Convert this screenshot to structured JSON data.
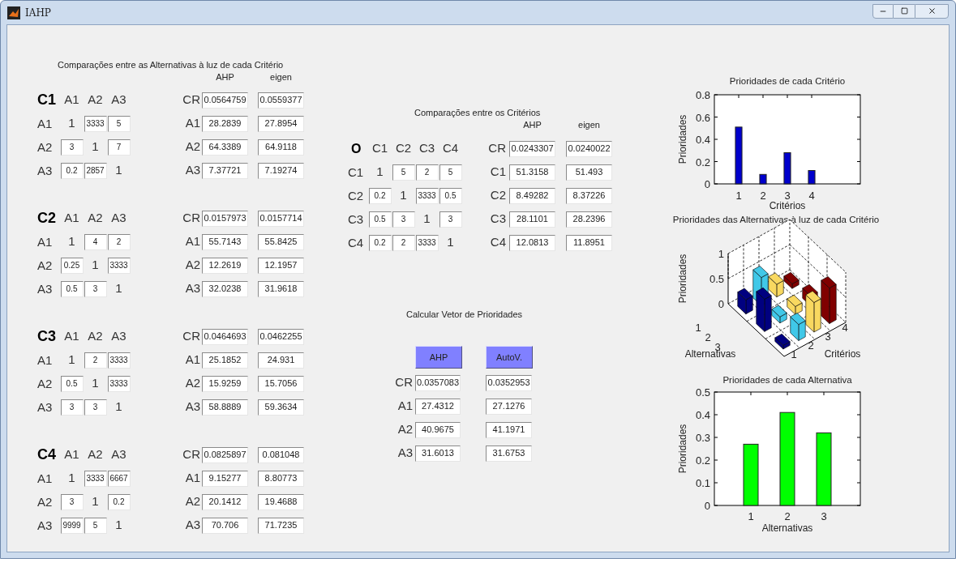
{
  "window": {
    "title": "IAHP"
  },
  "alternatives_panel": {
    "title": "Comparações entre as Alternativas à luz de cada Critério",
    "result_headers": [
      "AHP",
      "eigen"
    ],
    "blocks": [
      {
        "name": "C1",
        "columns": [
          "A1",
          "A2",
          "A3"
        ],
        "rows": [
          {
            "label": "A1",
            "cells": [
              {
                "kind": "text",
                "value": "1"
              },
              {
                "kind": "field",
                "value": "3333"
              },
              {
                "kind": "field",
                "value": "5"
              }
            ]
          },
          {
            "label": "A2",
            "cells": [
              {
                "kind": "field",
                "value": "3"
              },
              {
                "kind": "text",
                "value": "1"
              },
              {
                "kind": "field",
                "value": "7"
              }
            ]
          },
          {
            "label": "A3",
            "cells": [
              {
                "kind": "field",
                "value": "0.2"
              },
              {
                "kind": "field",
                "value": "2857"
              },
              {
                "kind": "text",
                "value": "1"
              }
            ]
          }
        ],
        "results": [
          {
            "label": "CR",
            "values": [
              "0.0564759",
              "0.0559377"
            ]
          },
          {
            "label": "A1",
            "values": [
              "28.2839",
              "27.8954"
            ]
          },
          {
            "label": "A2",
            "values": [
              "64.3389",
              "64.9118"
            ]
          },
          {
            "label": "A3",
            "values": [
              "7.37721",
              "7.19274"
            ]
          }
        ]
      },
      {
        "name": "C2",
        "columns": [
          "A1",
          "A2",
          "A3"
        ],
        "rows": [
          {
            "label": "A1",
            "cells": [
              {
                "kind": "text",
                "value": "1"
              },
              {
                "kind": "field",
                "value": "4"
              },
              {
                "kind": "field",
                "value": "2"
              }
            ]
          },
          {
            "label": "A2",
            "cells": [
              {
                "kind": "field",
                "value": "0.25"
              },
              {
                "kind": "text",
                "value": "1"
              },
              {
                "kind": "field",
                "value": "3333"
              }
            ]
          },
          {
            "label": "A3",
            "cells": [
              {
                "kind": "field",
                "value": "0.5"
              },
              {
                "kind": "field",
                "value": "3"
              },
              {
                "kind": "text",
                "value": "1"
              }
            ]
          }
        ],
        "results": [
          {
            "label": "CR",
            "values": [
              "0.0157973",
              "0.0157714"
            ]
          },
          {
            "label": "A1",
            "values": [
              "55.7143",
              "55.8425"
            ]
          },
          {
            "label": "A2",
            "values": [
              "12.2619",
              "12.1957"
            ]
          },
          {
            "label": "A3",
            "values": [
              "32.0238",
              "31.9618"
            ]
          }
        ]
      },
      {
        "name": "C3",
        "columns": [
          "A1",
          "A2",
          "A3"
        ],
        "rows": [
          {
            "label": "A1",
            "cells": [
              {
                "kind": "text",
                "value": "1"
              },
              {
                "kind": "field",
                "value": "2"
              },
              {
                "kind": "field",
                "value": "3333"
              }
            ]
          },
          {
            "label": "A2",
            "cells": [
              {
                "kind": "field",
                "value": "0.5"
              },
              {
                "kind": "text",
                "value": "1"
              },
              {
                "kind": "field",
                "value": "3333"
              }
            ]
          },
          {
            "label": "A3",
            "cells": [
              {
                "kind": "field",
                "value": "3"
              },
              {
                "kind": "field",
                "value": "3"
              },
              {
                "kind": "text",
                "value": "1"
              }
            ]
          }
        ],
        "results": [
          {
            "label": "CR",
            "values": [
              "0.0464693",
              "0.0462255"
            ]
          },
          {
            "label": "A1",
            "values": [
              "25.1852",
              "24.931"
            ]
          },
          {
            "label": "A2",
            "values": [
              "15.9259",
              "15.7056"
            ]
          },
          {
            "label": "A3",
            "values": [
              "58.8889",
              "59.3634"
            ]
          }
        ]
      },
      {
        "name": "C4",
        "columns": [
          "A1",
          "A2",
          "A3"
        ],
        "rows": [
          {
            "label": "A1",
            "cells": [
              {
                "kind": "text",
                "value": "1"
              },
              {
                "kind": "field",
                "value": "3333"
              },
              {
                "kind": "field",
                "value": "6667"
              }
            ]
          },
          {
            "label": "A2",
            "cells": [
              {
                "kind": "field",
                "value": "3"
              },
              {
                "kind": "text",
                "value": "1"
              },
              {
                "kind": "field",
                "value": "0.2"
              }
            ]
          },
          {
            "label": "A3",
            "cells": [
              {
                "kind": "field",
                "value": "9999"
              },
              {
                "kind": "field",
                "value": "5"
              },
              {
                "kind": "text",
                "value": "1"
              }
            ]
          }
        ],
        "results": [
          {
            "label": "CR",
            "values": [
              "0.0825897",
              "0.081048"
            ]
          },
          {
            "label": "A1",
            "values": [
              "9.15277",
              "8.80773"
            ]
          },
          {
            "label": "A2",
            "values": [
              "20.1412",
              "19.4688"
            ]
          },
          {
            "label": "A3",
            "values": [
              "70.706",
              "71.7235"
            ]
          }
        ]
      }
    ]
  },
  "criteria_panel": {
    "title": "Comparações entre os Critérios",
    "result_headers": [
      "AHP",
      "eigen"
    ],
    "corner": "O",
    "columns": [
      "C1",
      "C2",
      "C3",
      "C4"
    ],
    "rows": [
      {
        "label": "C1",
        "cells": [
          {
            "kind": "text",
            "value": "1"
          },
          {
            "kind": "field",
            "value": "5"
          },
          {
            "kind": "field",
            "value": "2"
          },
          {
            "kind": "field",
            "value": "5"
          }
        ]
      },
      {
        "label": "C2",
        "cells": [
          {
            "kind": "field",
            "value": "0.2"
          },
          {
            "kind": "text",
            "value": "1"
          },
          {
            "kind": "field",
            "value": "3333"
          },
          {
            "kind": "field",
            "value": "0.5"
          }
        ]
      },
      {
        "label": "C3",
        "cells": [
          {
            "kind": "field",
            "value": "0.5"
          },
          {
            "kind": "field",
            "value": "3"
          },
          {
            "kind": "text",
            "value": "1"
          },
          {
            "kind": "field",
            "value": "3"
          }
        ]
      },
      {
        "label": "C4",
        "cells": [
          {
            "kind": "field",
            "value": "0.2"
          },
          {
            "kind": "field",
            "value": "2"
          },
          {
            "kind": "field",
            "value": "3333"
          },
          {
            "kind": "text",
            "value": "1"
          }
        ]
      }
    ],
    "results": [
      {
        "label": "CR",
        "values": [
          "0.0243307",
          "0.0240022"
        ]
      },
      {
        "label": "C1",
        "values": [
          "51.3158",
          "51.493"
        ]
      },
      {
        "label": "C2",
        "values": [
          "8.49282",
          "8.37226"
        ]
      },
      {
        "label": "C3",
        "values": [
          "28.1101",
          "28.2396"
        ]
      },
      {
        "label": "C4",
        "values": [
          "12.0813",
          "11.8951"
        ]
      }
    ]
  },
  "calculation_panel": {
    "title": "Calcular Vetor de Prioridades",
    "buttons": [
      "AHP",
      "AutoV."
    ],
    "results": [
      {
        "label": "CR",
        "values": [
          "0.0357083",
          "0.0352953"
        ]
      },
      {
        "label": "A1",
        "values": [
          "27.4312",
          "27.1276"
        ]
      },
      {
        "label": "A2",
        "values": [
          "40.9675",
          "41.1971"
        ]
      },
      {
        "label": "A3",
        "values": [
          "31.6013",
          "31.6753"
        ]
      }
    ]
  },
  "criteria_chart": {
    "chart_data": {
      "type": "bar",
      "title": "Prioridades de cada Critério",
      "xlabel": "Critérios",
      "ylabel": "Prioridades",
      "categories": [
        "1",
        "2",
        "3",
        "4"
      ],
      "series": [
        {
          "color": "#0000cc",
          "values": [
            0.51,
            0.085,
            0.28,
            0.12
          ]
        }
      ],
      "ylim": [
        0,
        0.8
      ],
      "yticks": [
        0,
        0.2,
        0.4,
        0.6,
        0.8
      ]
    }
  },
  "alternatives_by_criterion_chart": {
    "title": "Prioridades das Alternativas à luz de cada Critério",
    "zlabel": "Prioridades",
    "alternatives_label": "Alternativas",
    "criteria_label": "Critérios",
    "zticks": [
      "1",
      "0.5",
      "0"
    ],
    "alternative_ticks": [
      "1",
      "2",
      "3"
    ],
    "criteria": [
      {
        "label": "1",
        "color": "#000080"
      },
      {
        "label": "2",
        "color": "#40c8e8"
      },
      {
        "label": "3",
        "color": "#f8d860"
      },
      {
        "label": "4",
        "color": "#800000"
      }
    ]
  },
  "alternatives_chart": {
    "chart_data": {
      "type": "bar",
      "title": "Prioridades de cada Alternativa",
      "xlabel": "Alternativas",
      "ylabel": "Prioridades",
      "categories": [
        "1",
        "2",
        "3"
      ],
      "series": [
        {
          "color": "#00ff00",
          "values": [
            0.27,
            0.41,
            0.32
          ]
        }
      ],
      "ylim": [
        0,
        0.5
      ],
      "yticks": [
        0,
        0.1,
        0.2,
        0.3,
        0.4,
        0.5
      ]
    }
  }
}
